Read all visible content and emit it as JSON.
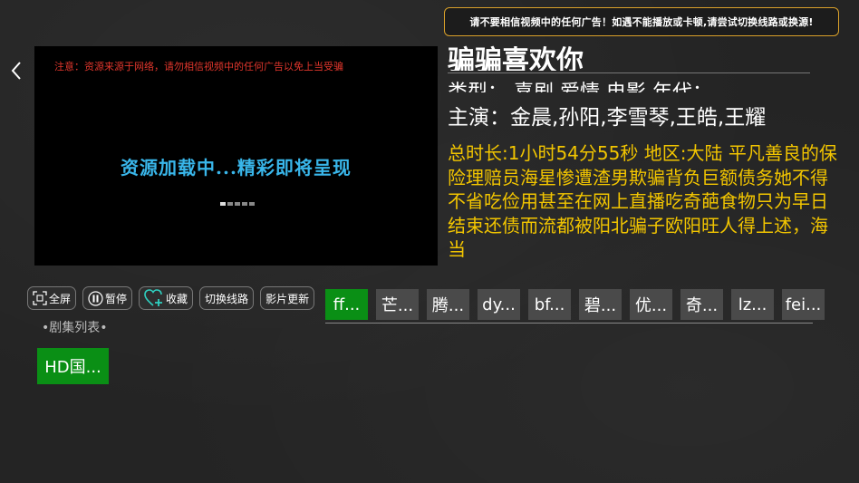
{
  "notice": "请不要相信视频中的任何广告！如遇不能播放或卡顿,请尝试切换线路或换源!",
  "player": {
    "warning": "注意：资源来源于网络，请勿相信视频中的任何广告以免上当受骗",
    "loading": "资源加载中...精彩即将呈现"
  },
  "movie": {
    "title": "骗骗喜欢你",
    "type_line": "类型： 喜剧,爱情,电影  年代：",
    "actors": "主演：金晨,孙阳,李雪琴,王皓,王耀",
    "description": "总时长:1小时54分55秒 地区:大陆 平凡善良的保险理赔员海星惨遭渣男欺骗背负巨额债务她不得不省吃俭用甚至在网上直播吃奇葩食物只为早日结束还债而流都被阳北骗子欧阳旺人得上述，海当"
  },
  "controls": [
    {
      "icon": "fullscreen-icon",
      "label": "全屏"
    },
    {
      "icon": "pause-icon",
      "label": "暂停"
    },
    {
      "icon": "favorite-heart-icon",
      "label": "收藏"
    },
    {
      "icon": "",
      "label": "切换线路"
    },
    {
      "icon": "",
      "label": "影片更新"
    }
  ],
  "sources": [
    "ff...",
    "芒...",
    "腾...",
    "dy...",
    "bf...",
    "碧...",
    "优...",
    "奇...",
    "lz...",
    "fei..."
  ],
  "active_source": 0,
  "episode_list_label": "•剧集列表•",
  "episodes": [
    "HD国..."
  ],
  "colors": {
    "accent_green": "#0a8f15",
    "notice_border": "#d9a02a",
    "description_yellow": "#f2c500",
    "loading_blue": "#39b6ea",
    "warning_red": "#e0362c"
  }
}
